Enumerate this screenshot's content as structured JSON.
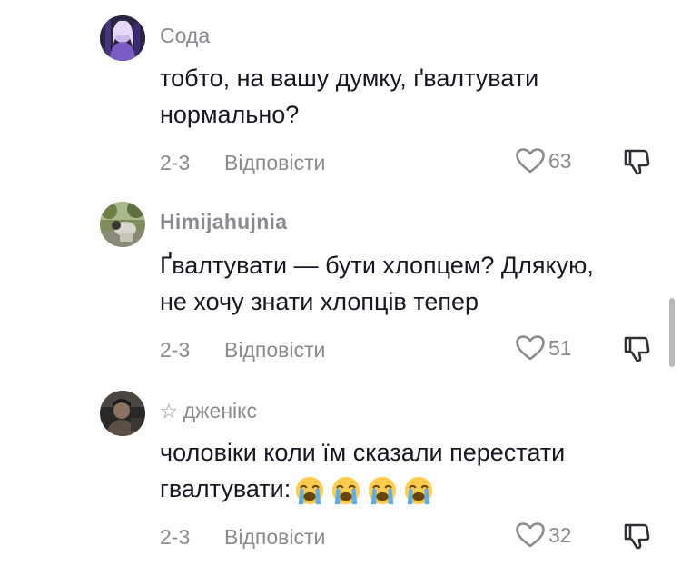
{
  "comments": [
    {
      "username": "Сода",
      "text_lines": [
        "тобто, на вашу думку, ґвалтувати",
        "нормально?"
      ],
      "date": "2-3",
      "reply_label": "Відповісти",
      "likes": "63",
      "avatar_icon": "avatar-purple-figure"
    },
    {
      "username": "Himijahujnia",
      "text_lines": [
        "Ґвалтувати — бути хлопцем? Длякую,",
        "не хочу знати хлопців тепер"
      ],
      "date": "2-3",
      "reply_label": "Відповісти",
      "likes": "51",
      "avatar_icon": "avatar-green-outdoor"
    },
    {
      "username": "дженікс",
      "username_prefix": "☆",
      "text_lines": [
        "чоловіки коли їм сказали перестати",
        "гвалтувати:"
      ],
      "text_emojis": [
        "loudly-crying-face",
        "loudly-crying-face",
        "loudly-crying-face",
        "loudly-crying-face"
      ],
      "date": "2-3",
      "reply_label": "Відповісти",
      "likes": "32",
      "avatar_icon": "avatar-dark-photo"
    }
  ],
  "colors": {
    "text": "#161823",
    "secondary": "#8a8b91",
    "background": "#ffffff"
  }
}
